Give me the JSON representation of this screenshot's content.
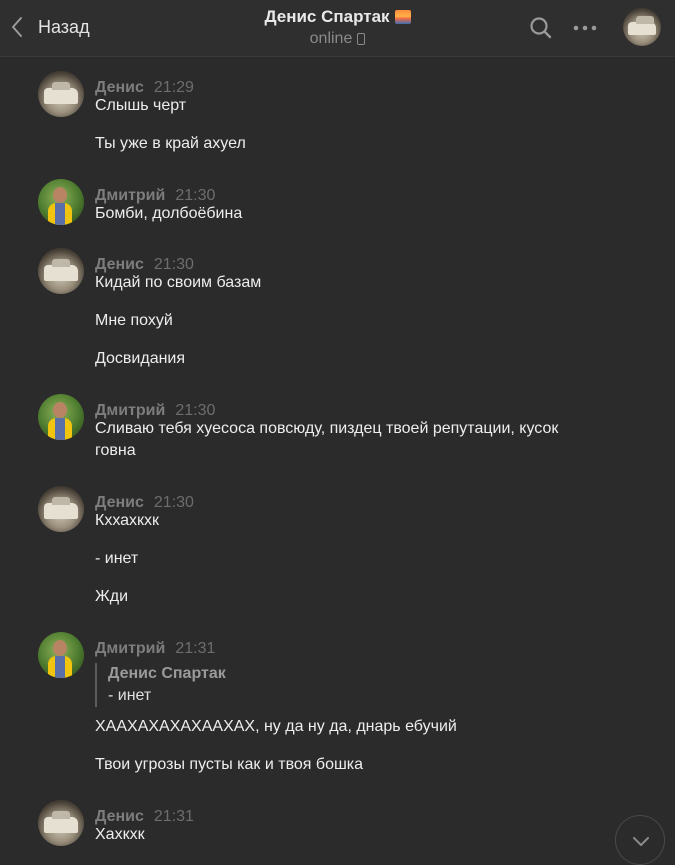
{
  "header": {
    "back_label": "Назад",
    "title": "Денис Спартак",
    "status": "online"
  },
  "messages": [
    {
      "author": "Денис",
      "time": "21:29",
      "avatar": "car",
      "lines": [
        "Слышь черт",
        "Ты уже в край ахуел"
      ]
    },
    {
      "author": "Дмитрий",
      "time": "21:30",
      "avatar": "man",
      "lines": [
        "Бомби, долбоёбина"
      ]
    },
    {
      "author": "Денис",
      "time": "21:30",
      "avatar": "car",
      "lines": [
        "Кидай по своим базам",
        "Мне похуй",
        "Досвидания"
      ]
    },
    {
      "author": "Дмитрий",
      "time": "21:30",
      "avatar": "man",
      "lines": [
        "Сливаю тебя хуесоса повсюду, пиздец твоей репутации, кусок говна"
      ]
    },
    {
      "author": "Денис",
      "time": "21:30",
      "avatar": "car",
      "lines": [
        "Кххахкхк",
        "- инет",
        "Жди"
      ]
    },
    {
      "author": "Дмитрий",
      "time": "21:31",
      "avatar": "man",
      "quote": {
        "author": "Денис Спартак",
        "text": "- инет"
      },
      "lines": [
        "ХААХАХАХАХААХАХ, ну да ну да, днарь ебучий",
        "Твои угрозы пусты как и твоя бошка"
      ]
    },
    {
      "author": "Денис",
      "time": "21:31",
      "avatar": "car",
      "lines": [
        "Хахкхк"
      ]
    }
  ],
  "icons": {
    "back": "chevron-left-icon",
    "search": "search-icon",
    "more": "more-dots-icon",
    "scroll_down": "chevron-down-icon"
  }
}
